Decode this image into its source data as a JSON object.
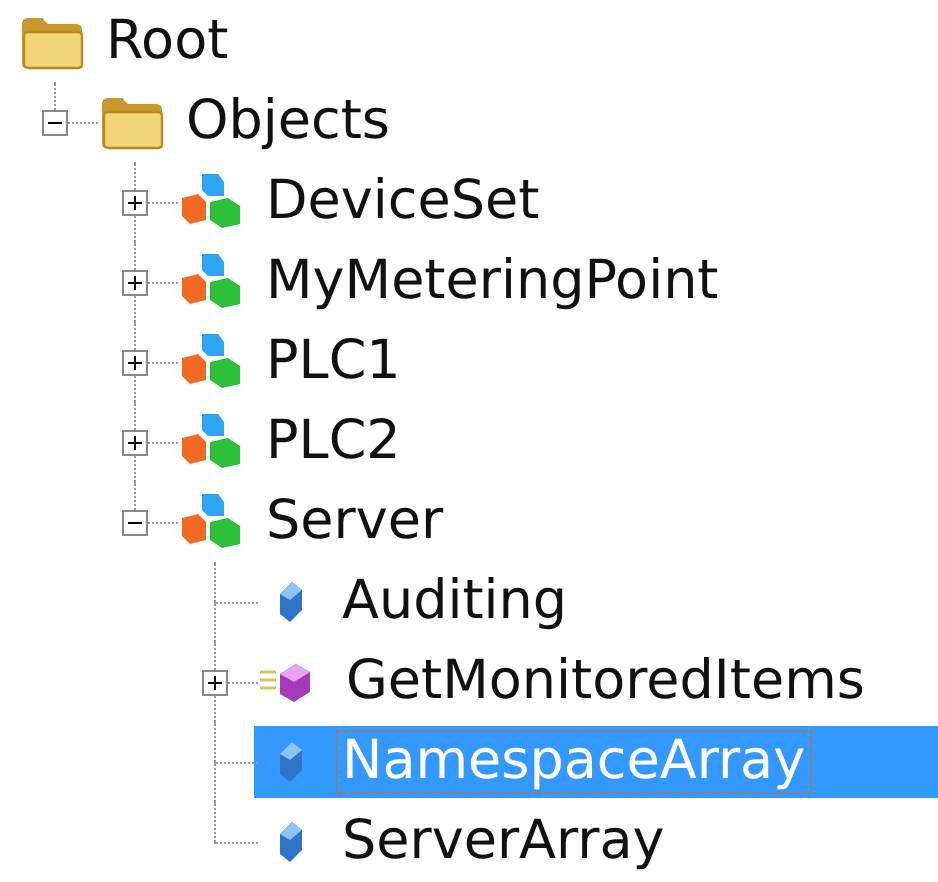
{
  "tree": [
    {
      "label": "Root",
      "kind": "folder",
      "selected": false,
      "children": [
        {
          "label": "Objects",
          "kind": "folder",
          "expanded": true,
          "selected": false,
          "children": [
            {
              "label": "DeviceSet",
              "kind": "object",
              "expanded": false,
              "selected": false
            },
            {
              "label": "MyMeteringPoint",
              "kind": "object",
              "expanded": false,
              "selected": false
            },
            {
              "label": "PLC1",
              "kind": "object",
              "expanded": false,
              "selected": false
            },
            {
              "label": "PLC2",
              "kind": "object",
              "expanded": false,
              "selected": false
            },
            {
              "label": "Server",
              "kind": "object",
              "expanded": true,
              "selected": false,
              "children": [
                {
                  "label": "Auditing",
                  "kind": "variable",
                  "selected": false
                },
                {
                  "label": "GetMonitoredItems",
                  "kind": "method",
                  "expanded": false,
                  "selected": false
                },
                {
                  "label": "NamespaceArray",
                  "kind": "variable",
                  "selected": true
                },
                {
                  "label": "ServerArray",
                  "kind": "variable",
                  "selected": false
                }
              ]
            }
          ]
        }
      ]
    }
  ]
}
